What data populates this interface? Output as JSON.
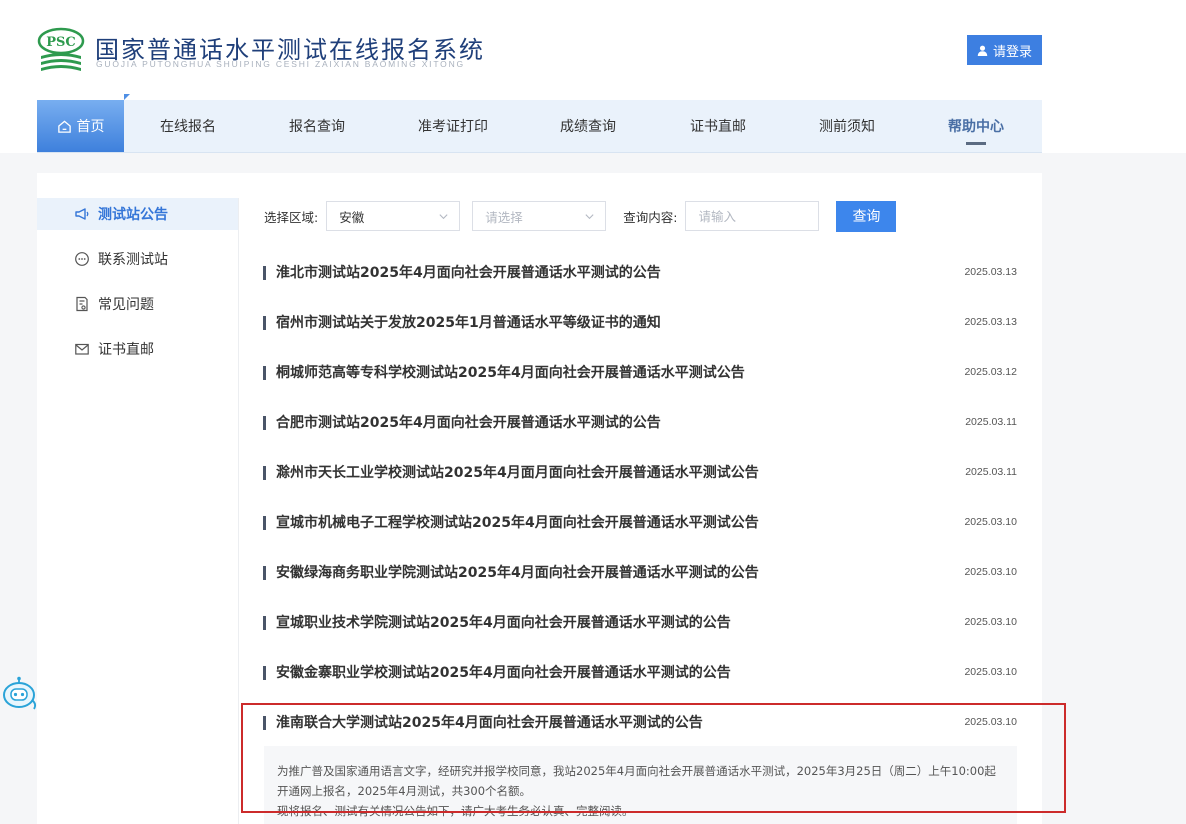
{
  "header": {
    "title": "国家普通话水平测试在线报名系统",
    "subtitle": "GUOJIA PUTONGHUA SHUIPING CESHI ZAIXIAN BAOMING XITONG",
    "logo_text": "PSC",
    "login_label": "请登录",
    "login_icon": "user-icon"
  },
  "nav": {
    "home": "首页",
    "items": [
      "在线报名",
      "报名查询",
      "准考证打印",
      "成绩查询",
      "证书直邮",
      "测前须知",
      "帮助中心"
    ]
  },
  "sidebar": {
    "items": [
      {
        "label": "测试站公告",
        "icon": "megaphone-icon"
      },
      {
        "label": "联系测试站",
        "icon": "chat-icon"
      },
      {
        "label": "常见问题",
        "icon": "faq-icon"
      },
      {
        "label": "证书直邮",
        "icon": "mail-icon"
      }
    ]
  },
  "filter": {
    "region_label": "选择区域:",
    "region_value": "安徽",
    "city_placeholder": "请选择",
    "query_label": "查询内容:",
    "query_placeholder": "请输入",
    "query_button": "查询"
  },
  "announcements": [
    {
      "title": "淮北市测试站2025年4月面向社会开展普通话水平测试的公告",
      "date": "2025.03.13"
    },
    {
      "title": "宿州市测试站关于发放2025年1月普通话水平等级证书的通知",
      "date": "2025.03.13"
    },
    {
      "title": "桐城师范高等专科学校测试站2025年4月面向社会开展普通话水平测试公告",
      "date": "2025.03.12"
    },
    {
      "title": "合肥市测试站2025年4月面向社会开展普通话水平测试的公告",
      "date": "2025.03.11"
    },
    {
      "title": "滁州市天长工业学校测试站2025年4月面月面向社会开展普通话水平测试公告",
      "date": "2025.03.11"
    },
    {
      "title": "宣城市机械电子工程学校测试站2025年4月面向社会开展普通话水平测试公告",
      "date": "2025.03.10"
    },
    {
      "title": "安徽绿海商务职业学院测试站2025年4月面向社会开展普通话水平测试的公告",
      "date": "2025.03.10"
    },
    {
      "title": "宣城职业技术学院测试站2025年4月面向社会开展普通话水平测试的公告",
      "date": "2025.03.10"
    },
    {
      "title": "安徽金寨职业学校测试站2025年4月面向社会开展普通话水平测试的公告",
      "date": "2025.03.10"
    },
    {
      "title": "淮南联合大学测试站2025年4月面向社会开展普通话水平测试的公告",
      "date": "2025.03.10"
    }
  ],
  "excerpt": {
    "line1": "为推广普及国家通用语言文字，经研究并报学校同意，我站2025年4月面向社会开展普通话水平测试，2025年3月25日（周二）上午10:00起开通网上报名，2025年4月测试，共300个名额。",
    "line2": "现将报名、测试有关情况公告如下，请广大考生务必认真、完整阅读。"
  }
}
